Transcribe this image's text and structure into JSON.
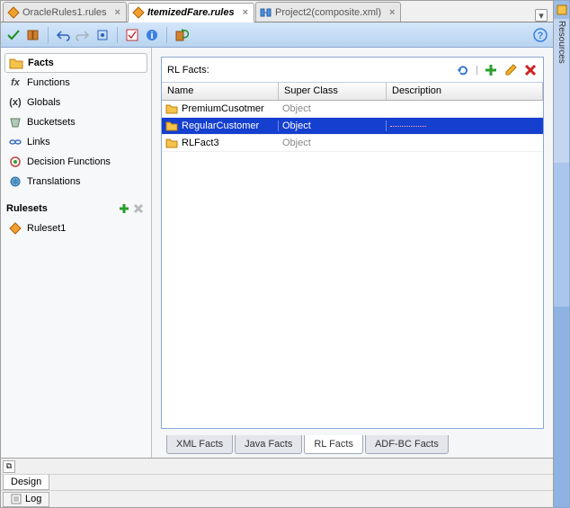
{
  "colors": {
    "accent": "#153fcf"
  },
  "topTabs": {
    "tabs": [
      {
        "label": "OracleRules1.rules",
        "active": false
      },
      {
        "label": "ItemizedFare.rules",
        "active": true
      },
      {
        "label": "Project2(composite.xml)",
        "active": false
      }
    ]
  },
  "sidebar": {
    "items": [
      {
        "icon": "folder-icon",
        "label": "Facts",
        "selected": true
      },
      {
        "icon": "fx-icon",
        "label": "Functions"
      },
      {
        "icon": "globals-icon",
        "label": "Globals"
      },
      {
        "icon": "bucketsets-icon",
        "label": "Bucketsets"
      },
      {
        "icon": "links-icon",
        "label": "Links"
      },
      {
        "icon": "decision-icon",
        "label": "Decision Functions"
      },
      {
        "icon": "translate-icon",
        "label": "Translations"
      }
    ],
    "rulesetsHeader": "Rulesets",
    "rulesets": [
      {
        "icon": "ruleset-icon",
        "label": "Ruleset1"
      }
    ]
  },
  "panel": {
    "title": "RL Facts:",
    "columns": {
      "name": "Name",
      "superClass": "Super Class",
      "description": "Description"
    },
    "rows": [
      {
        "name": "PremiumCusotmer",
        "superClass": "Object",
        "description": "",
        "selected": false
      },
      {
        "name": "RegularCustomer",
        "superClass": "Object",
        "description": "",
        "selected": true
      },
      {
        "name": "RLFact3",
        "superClass": "Object",
        "description": "",
        "selected": false
      }
    ],
    "factsTabs": [
      {
        "label": "XML Facts",
        "active": false
      },
      {
        "label": "Java Facts",
        "active": false
      },
      {
        "label": "RL Facts",
        "active": true
      },
      {
        "label": "ADF-BC Facts",
        "active": false
      }
    ]
  },
  "bottom": {
    "designTab": "Design",
    "logTab": "Log"
  },
  "resourcesLabel": "Resources"
}
